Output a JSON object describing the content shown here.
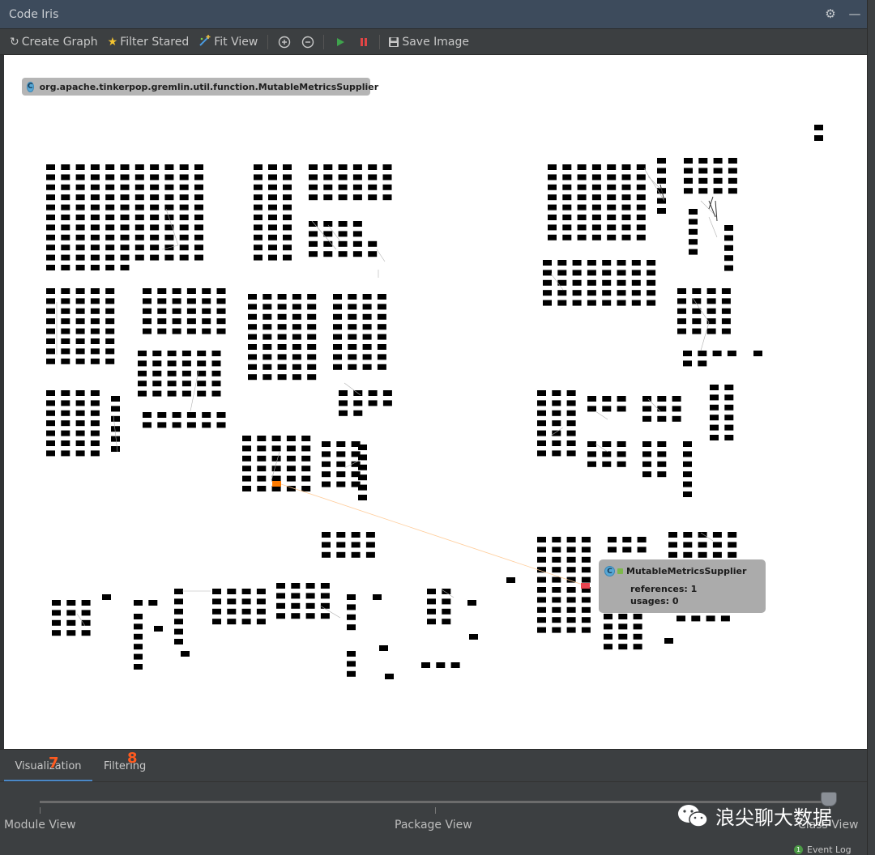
{
  "window": {
    "title": "Code Iris"
  },
  "title_controls": {
    "settings_icon": "gear-icon",
    "minimize_icon": "minimize-icon"
  },
  "toolbar": {
    "create_graph": "Create Graph",
    "filter_stared": "Filter Stared",
    "fit_view": "Fit View",
    "zoom_in_icon": "zoom-in-icon",
    "zoom_out_icon": "zoom-out-icon",
    "run_icon": "play-icon",
    "stop_icon": "stop-icon",
    "save_image": "Save Image"
  },
  "graph": {
    "selected_node_label": "org.apache.tinkerpop.gremlin.util.function.MutableMetricsSupplier",
    "tooltip": {
      "name": "MutableMetricsSupplier",
      "references": "references: 1",
      "usages": "usages: 0"
    },
    "colors": {
      "node": "#ffff99",
      "highlight_source": "#ff7b00",
      "highlight_target": "#e8434f",
      "edge": "#b0b0b0"
    }
  },
  "tabs": [
    {
      "label": "Visualization",
      "badge": "7",
      "active": true
    },
    {
      "label": "Filtering",
      "badge": "8",
      "active": false
    }
  ],
  "view_slider": {
    "labels": [
      "Module View",
      "Package View",
      "Class View"
    ],
    "selected": "Class View"
  },
  "watermark": {
    "text": "浪尖聊大数据"
  },
  "status": {
    "event_log": "Event Log",
    "event_count": "1"
  }
}
